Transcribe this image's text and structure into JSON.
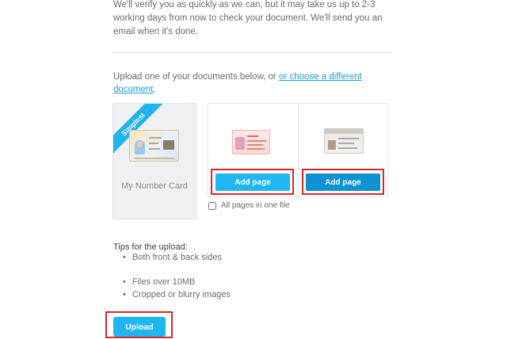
{
  "intro": {
    "text": "We'll verify you as quickly as we can, but it may take us up to 2-3 working days from now to check your document. We'll send you an email when it's done."
  },
  "upload_instructions": {
    "prefix": "Upload one of your documents below, or ",
    "link": "or choose a different document",
    "link_text": "or choose a different document",
    "suffix": "."
  },
  "documents": {
    "my_number": {
      "ribbon": "Simplest",
      "label": "My Number Card",
      "icon": "my-number-card-icon"
    },
    "page1": {
      "icon": "driver-license-card-icon",
      "button": "Add page"
    },
    "page2": {
      "icon": "residence-card-icon",
      "button": "Add page"
    },
    "single_file": {
      "label": "All pages in one file",
      "checked": false
    }
  },
  "tips": {
    "title": "Tips for the upload:",
    "items": [
      "Both front & back sides",
      "Files over 10MB",
      "Cropped or blurry images"
    ]
  },
  "upload_button": "Upload",
  "colors": {
    "accent": "#1fb6f4",
    "accent_dark": "#0d93d5",
    "highlight": "#d9262c",
    "link": "#1a9fe0"
  }
}
